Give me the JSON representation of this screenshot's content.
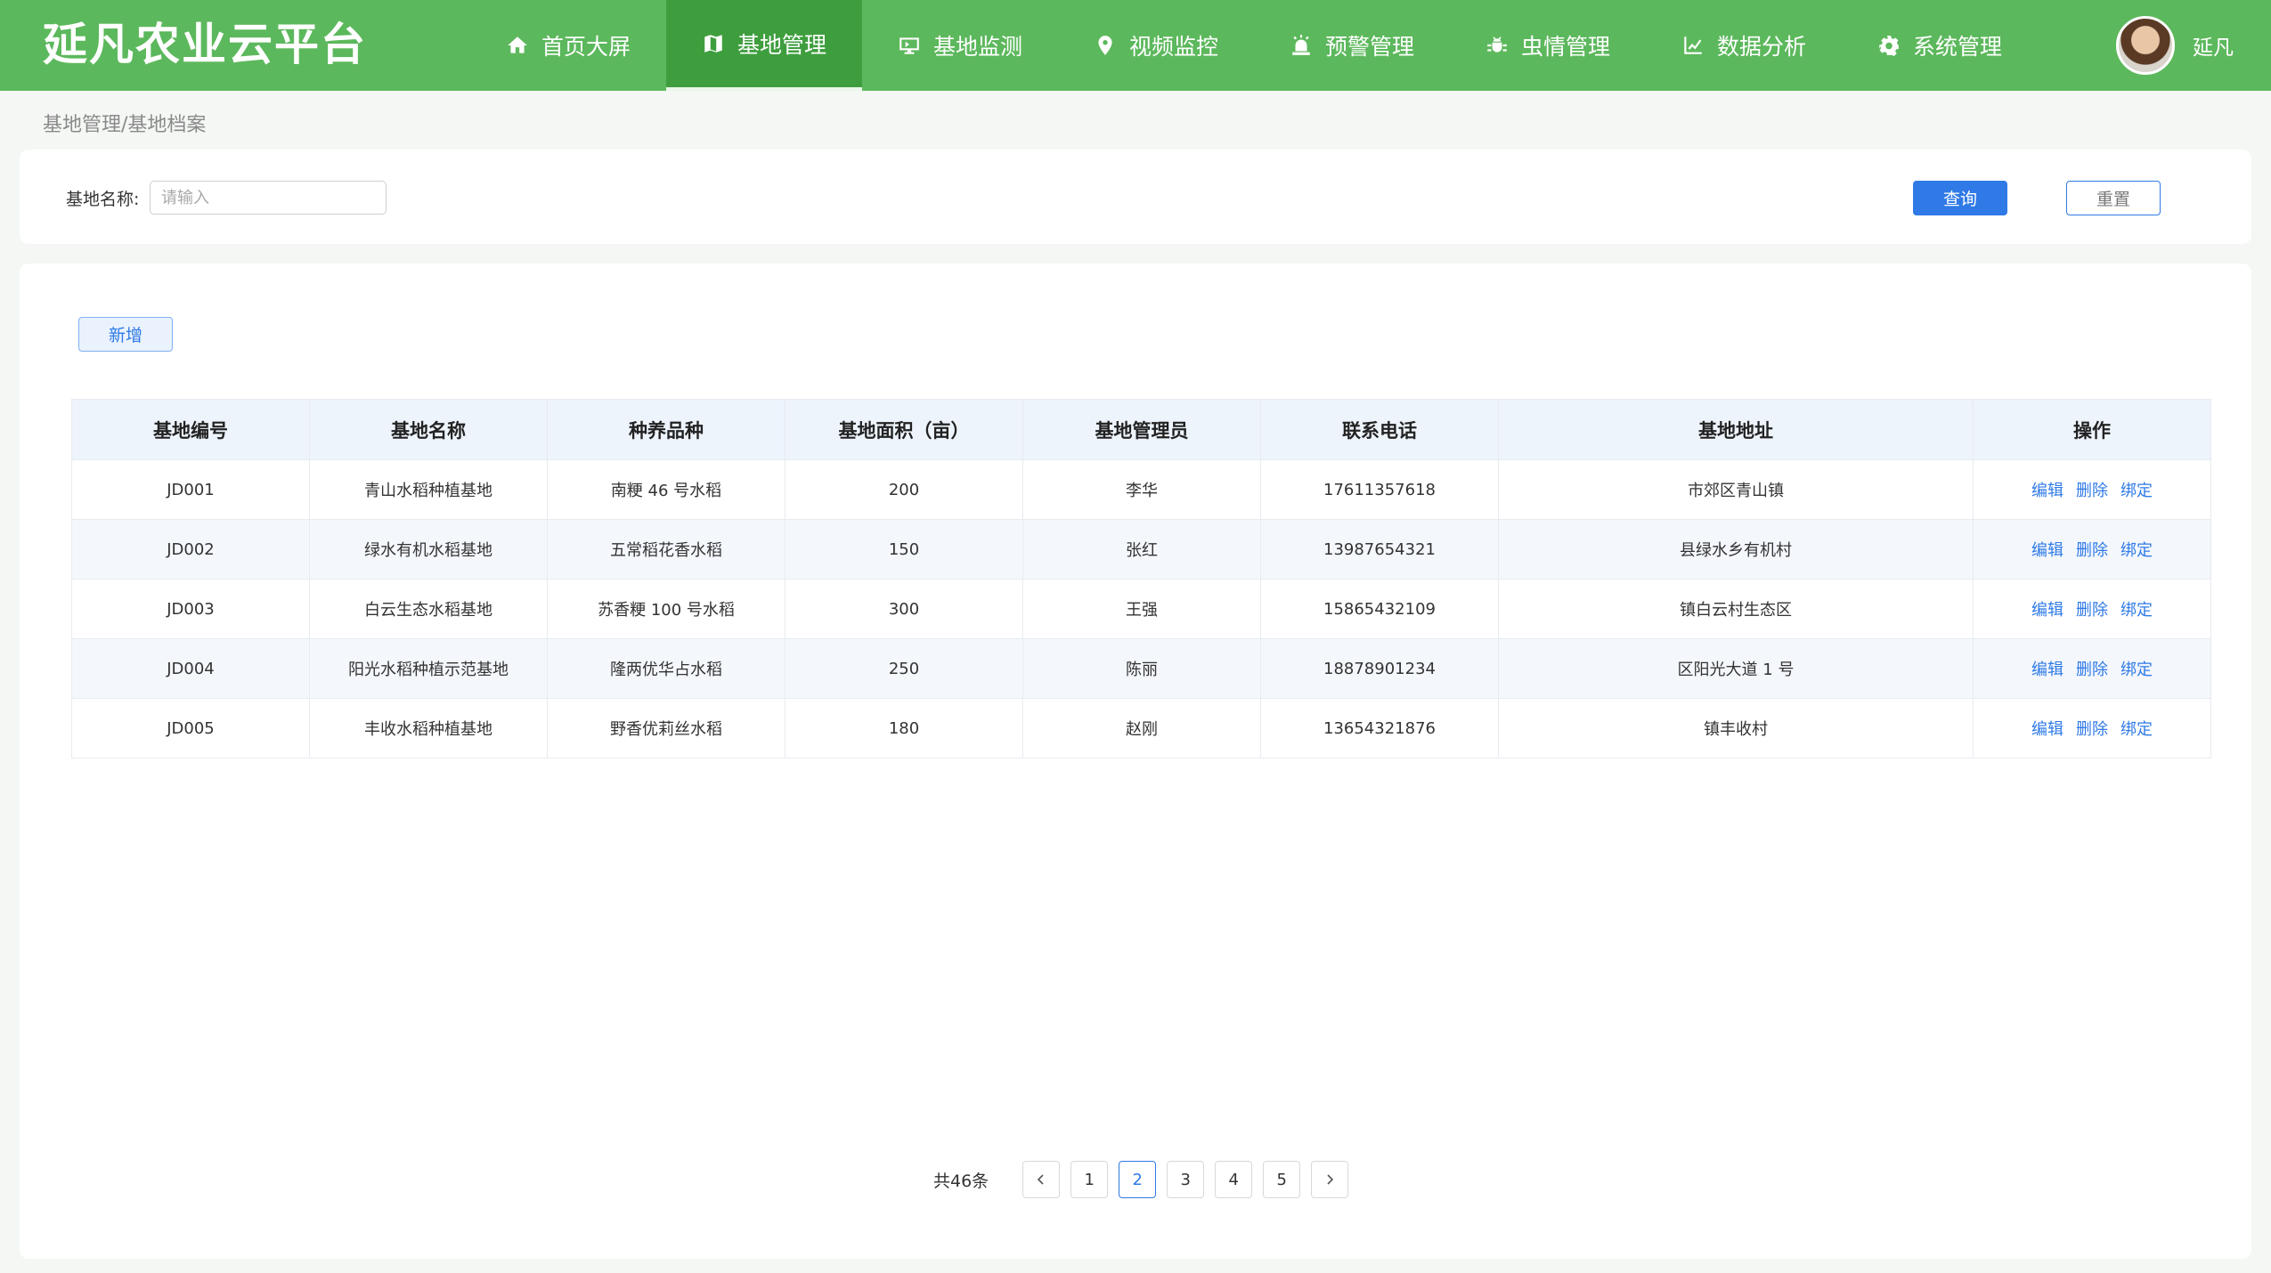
{
  "app": {
    "title": "延凡农业云平台"
  },
  "nav": {
    "items": [
      {
        "label": "首页大屏",
        "icon": "home-icon"
      },
      {
        "label": "基地管理",
        "icon": "map-icon",
        "active": true
      },
      {
        "label": "基地监测",
        "icon": "monitor-icon"
      },
      {
        "label": "视频监控",
        "icon": "location-pin-icon"
      },
      {
        "label": "预警管理",
        "icon": "alarm-icon"
      },
      {
        "label": "虫情管理",
        "icon": "bug-icon"
      },
      {
        "label": "数据分析",
        "icon": "chart-icon"
      },
      {
        "label": "系统管理",
        "icon": "gear-icon"
      }
    ]
  },
  "user": {
    "name": "延凡",
    "avatar": "avatar-photo"
  },
  "breadcrumb": "基地管理/基地档案",
  "search": {
    "label": "基地名称:",
    "placeholder": "请输入",
    "value": "",
    "query_label": "查询",
    "reset_label": "重置"
  },
  "toolbar": {
    "add_label": "新增"
  },
  "table": {
    "headers": [
      "基地编号",
      "基地名称",
      "种养品种",
      "基地面积（亩）",
      "基地管理员",
      "联系电话",
      "基地地址",
      "操作"
    ],
    "rows": [
      [
        "JD001",
        "青山水稻种植基地",
        "南粳 46 号水稻",
        "200",
        "李华",
        "17611357618",
        "市郊区青山镇"
      ],
      [
        "JD002",
        "绿水有机水稻基地",
        "五常稻花香水稻",
        "150",
        "张红",
        "13987654321",
        "县绿水乡有机村"
      ],
      [
        "JD003",
        "白云生态水稻基地",
        "苏香粳 100 号水稻",
        "300",
        "王强",
        "15865432109",
        "镇白云村生态区"
      ],
      [
        "JD004",
        "阳光水稻种植示范基地",
        "隆两优华占水稻",
        "250",
        "陈丽",
        "18878901234",
        "区阳光大道 1 号"
      ],
      [
        "JD005",
        "丰收水稻种植基地",
        "野香优莉丝水稻",
        "180",
        "赵刚",
        "13654321876",
        "镇丰收村"
      ]
    ],
    "actions": {
      "edit": "编辑",
      "delete": "删除",
      "bind": "绑定"
    }
  },
  "pagination": {
    "total_label": "共46条",
    "pages": [
      "1",
      "2",
      "3",
      "4",
      "5"
    ],
    "current": "2",
    "prev_icon": "chevron-left-icon",
    "next_icon": "chevron-right-icon"
  },
  "colors": {
    "header_bg": "#5cb85c",
    "nav_active_bg": "#3e9e3e",
    "primary": "#2f7ae6",
    "table_header_bg": "#eef4fc"
  }
}
